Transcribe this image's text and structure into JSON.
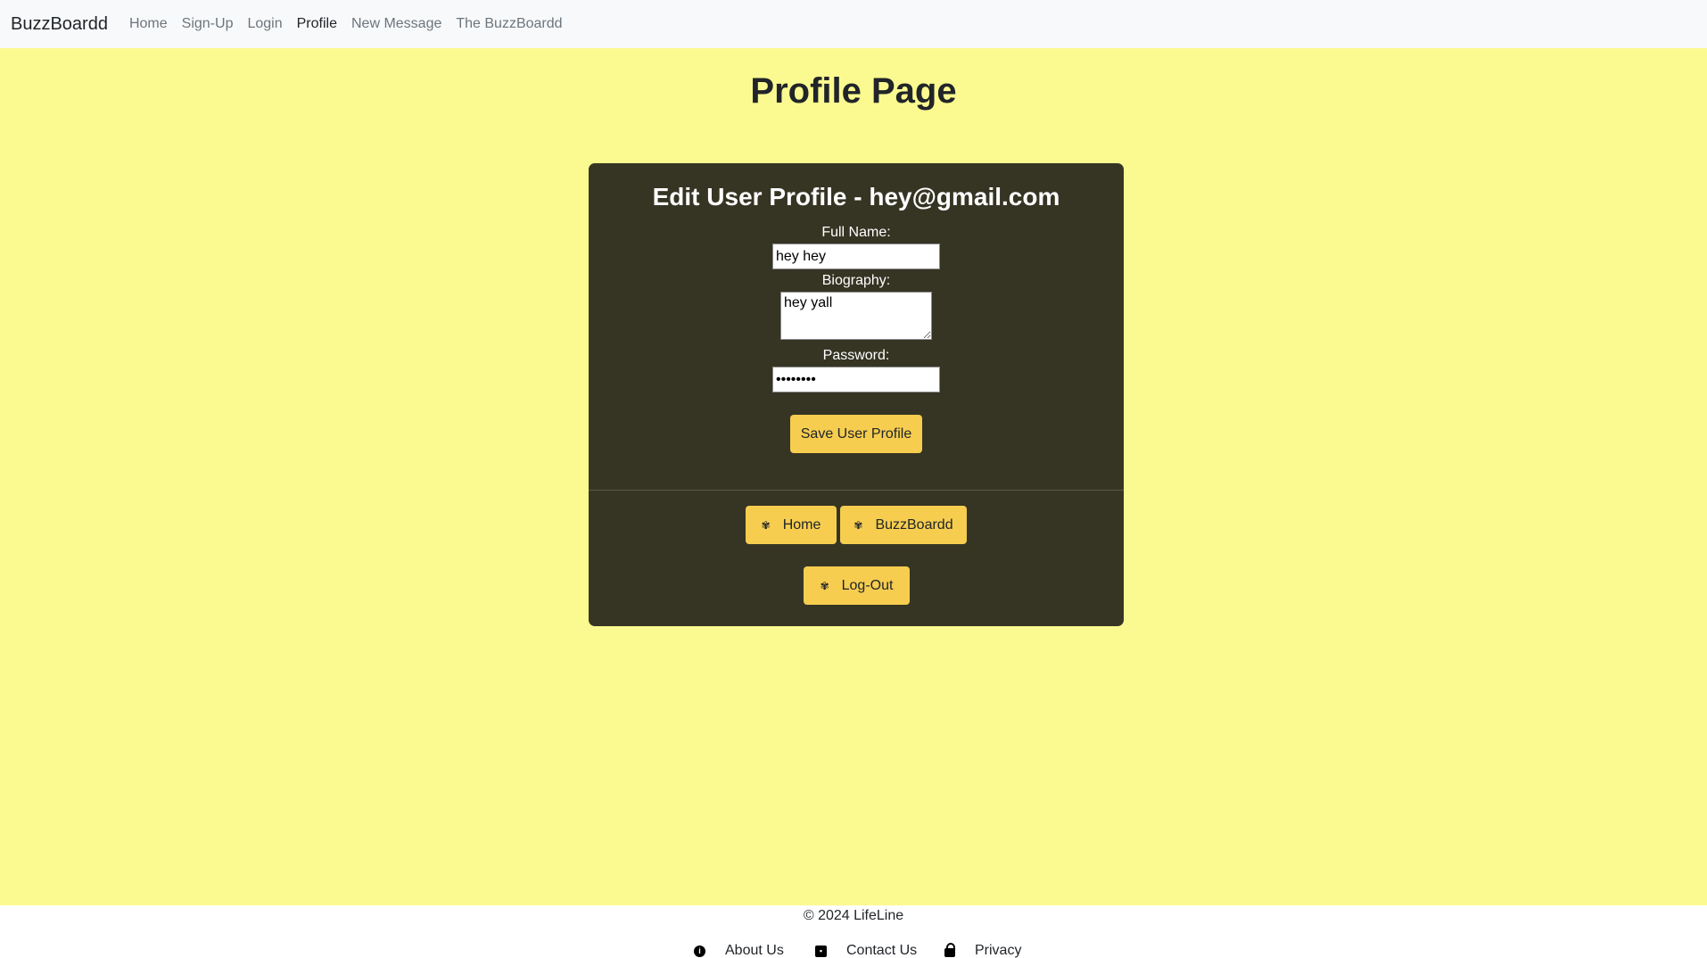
{
  "nav": {
    "brand": "BuzzBoardd",
    "links": [
      "Home",
      "Sign-Up",
      "Login",
      "Profile",
      "New Message",
      "The BuzzBoardd"
    ]
  },
  "page": {
    "title": "Profile Page"
  },
  "form": {
    "title": "Edit User Profile - hey@gmail.com",
    "full_name_label": "Full Name:",
    "full_name_value": "hey hey",
    "bio_label": "Biography:",
    "bio_value": "hey yall",
    "password_label": "Password:",
    "password_value": "heyheyhe",
    "save_label": "Save User Profile"
  },
  "actions": {
    "home_label": "Home",
    "board_label": "BuzzBoardd",
    "logout_label": "Log-Out",
    "icon": "bee-icon"
  },
  "footer": {
    "copyright": "© 2024 LifeLine",
    "about_label": "About Us",
    "contact_label": "Contact Us",
    "privacy_label": "Privacy"
  },
  "colors": {
    "page_bg": "#fbfa90",
    "card_bg": "#363524",
    "button_bg": "#f6cd4f",
    "navbar_bg": "#f8f9fa"
  }
}
